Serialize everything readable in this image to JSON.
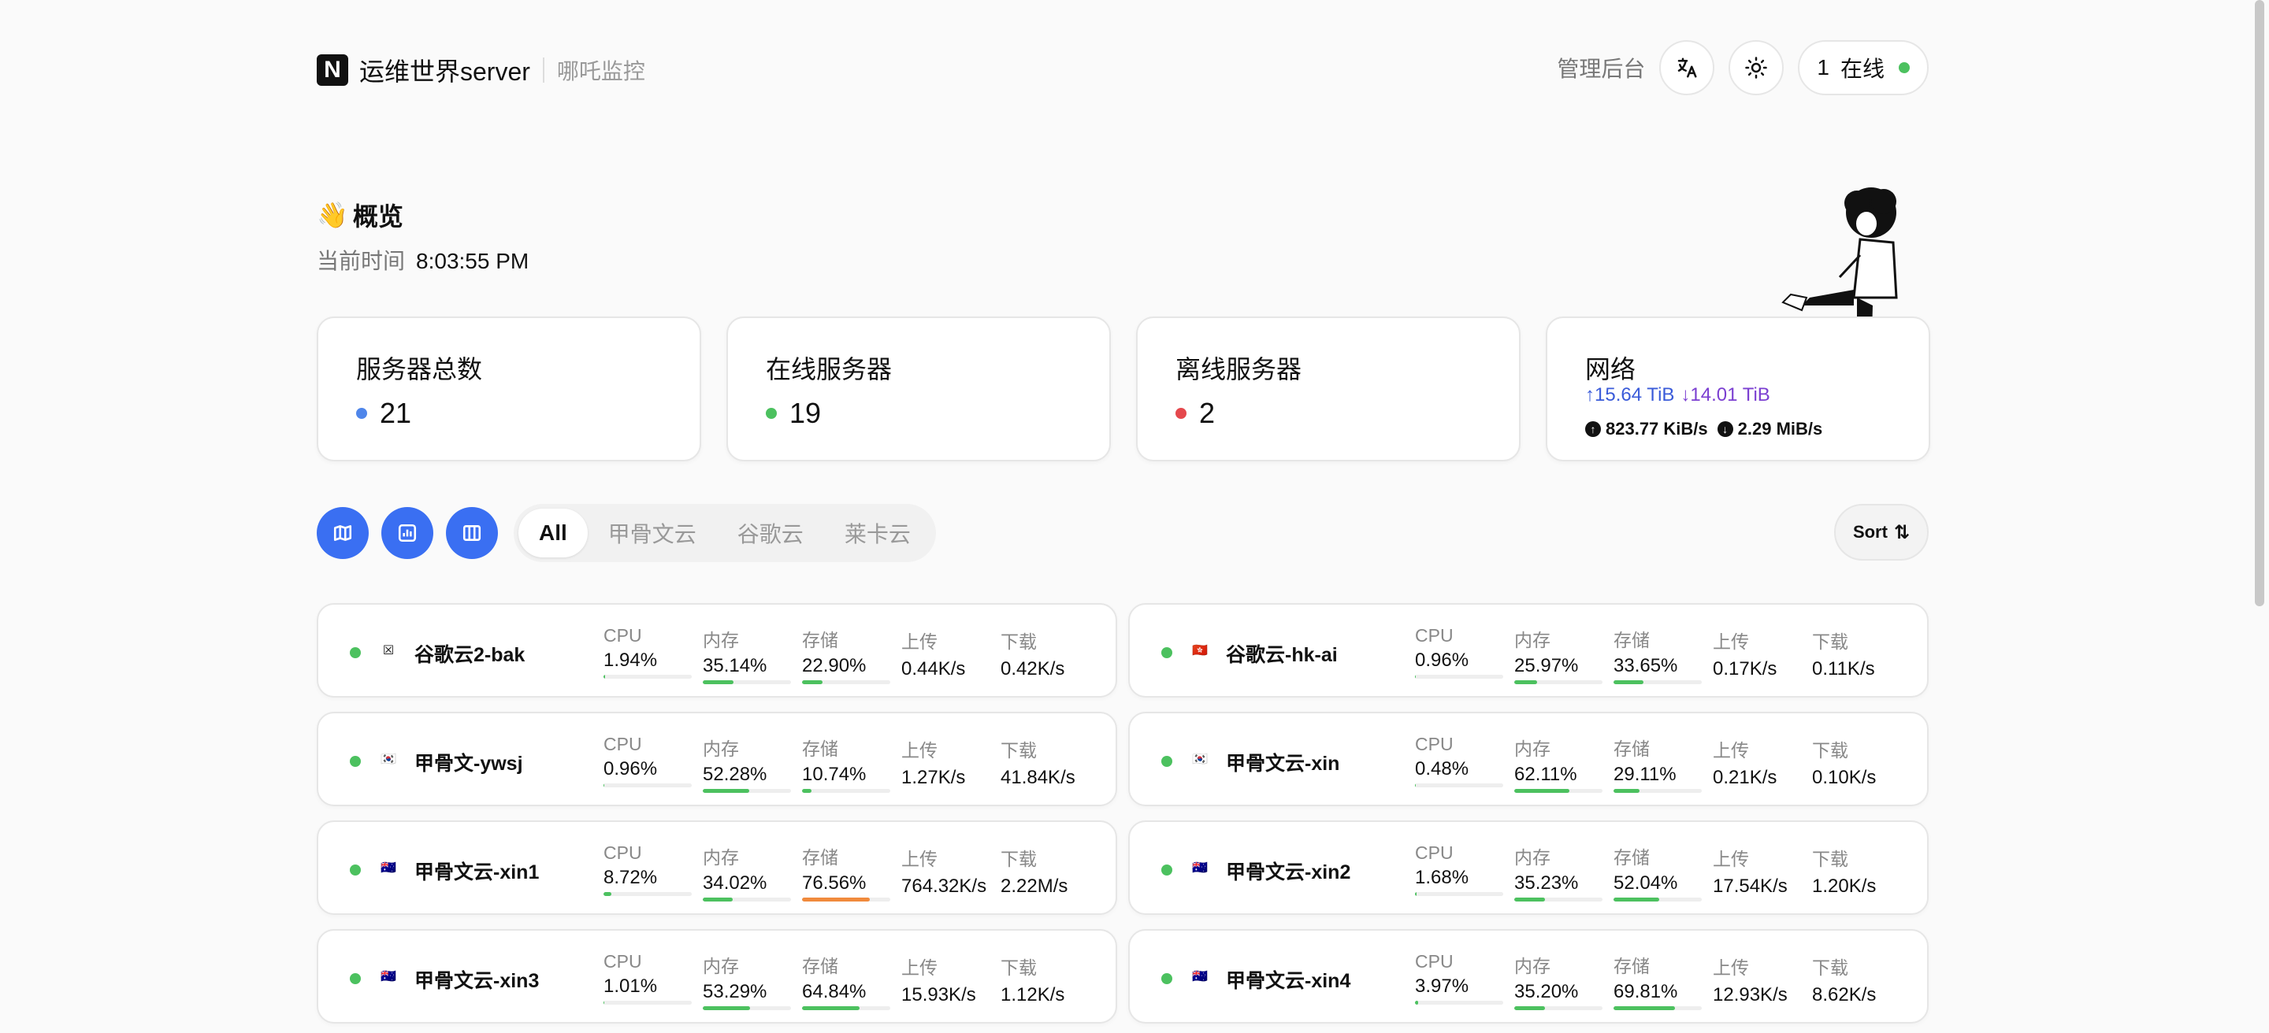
{
  "header": {
    "logo_letter": "N",
    "site_title": "运维世界server",
    "site_subtitle": "哪吒监控",
    "admin_label": "管理后台",
    "online_count": "1",
    "online_label": "在线"
  },
  "overview": {
    "wave": "👋",
    "title": "概览",
    "time_label": "当前时间",
    "time_value": "8:03:55 PM"
  },
  "stats": {
    "total": {
      "label": "服务器总数",
      "value": "21",
      "color": "#4f86ea"
    },
    "online": {
      "label": "在线服务器",
      "value": "19",
      "color": "#4cc15f"
    },
    "offline": {
      "label": "离线服务器",
      "value": "2",
      "color": "#e5484d"
    },
    "network": {
      "label": "网络",
      "total_up": "↑15.64 TiB",
      "total_down": "↓14.01 TiB",
      "speed_up": "823.77 KiB/s",
      "speed_down": "2.29 MiB/s"
    }
  },
  "toolbar": {
    "views": [
      "map-view",
      "chart-view",
      "grid-view"
    ],
    "tabs": [
      "All",
      "甲骨文云",
      "谷歌云",
      "莱卡云"
    ],
    "active_tab": "All",
    "sort_label": "Sort"
  },
  "labels": {
    "cpu": "CPU",
    "mem": "内存",
    "disk": "存储",
    "up": "上传",
    "down": "下载"
  },
  "servers": [
    {
      "name": "谷歌云2-bak",
      "flag": "☒",
      "cpu": "1.94%",
      "cpu_pct": 1.94,
      "mem": "35.14%",
      "mem_pct": 35.14,
      "disk": "22.90%",
      "disk_pct": 22.9,
      "up": "0.44K/s",
      "down": "0.42K/s"
    },
    {
      "name": "谷歌云-hk-ai",
      "flag": "🇭🇰",
      "cpu": "0.96%",
      "cpu_pct": 0.96,
      "mem": "25.97%",
      "mem_pct": 25.97,
      "disk": "33.65%",
      "disk_pct": 33.65,
      "up": "0.17K/s",
      "down": "0.11K/s"
    },
    {
      "name": "甲骨文-ywsj",
      "flag": "🇰🇷",
      "cpu": "0.96%",
      "cpu_pct": 0.96,
      "mem": "52.28%",
      "mem_pct": 52.28,
      "disk": "10.74%",
      "disk_pct": 10.74,
      "up": "1.27K/s",
      "down": "41.84K/s"
    },
    {
      "name": "甲骨文云-xin",
      "flag": "🇰🇷",
      "cpu": "0.48%",
      "cpu_pct": 0.48,
      "mem": "62.11%",
      "mem_pct": 62.11,
      "disk": "29.11%",
      "disk_pct": 29.11,
      "up": "0.21K/s",
      "down": "0.10K/s"
    },
    {
      "name": "甲骨文云-xin1",
      "flag": "🇦🇺",
      "cpu": "8.72%",
      "cpu_pct": 8.72,
      "mem": "34.02%",
      "mem_pct": 34.02,
      "disk": "76.56%",
      "disk_pct": 76.56,
      "up": "764.32K/s",
      "down": "2.22M/s"
    },
    {
      "name": "甲骨文云-xin2",
      "flag": "🇦🇺",
      "cpu": "1.68%",
      "cpu_pct": 1.68,
      "mem": "35.23%",
      "mem_pct": 35.23,
      "disk": "52.04%",
      "disk_pct": 52.04,
      "up": "17.54K/s",
      "down": "1.20K/s"
    },
    {
      "name": "甲骨文云-xin3",
      "flag": "🇦🇺",
      "cpu": "1.01%",
      "cpu_pct": 1.01,
      "mem": "53.29%",
      "mem_pct": 53.29,
      "disk": "64.84%",
      "disk_pct": 64.84,
      "up": "15.93K/s",
      "down": "1.12K/s"
    },
    {
      "name": "甲骨文云-xin4",
      "flag": "🇦🇺",
      "cpu": "3.97%",
      "cpu_pct": 3.97,
      "mem": "35.20%",
      "mem_pct": 35.2,
      "disk": "69.81%",
      "disk_pct": 69.81,
      "up": "12.93K/s",
      "down": "8.62K/s"
    }
  ],
  "colors": {
    "bar_ok": "#4cc15f",
    "bar_warn": "#f08a3c",
    "accent": "#3a6ff2"
  }
}
